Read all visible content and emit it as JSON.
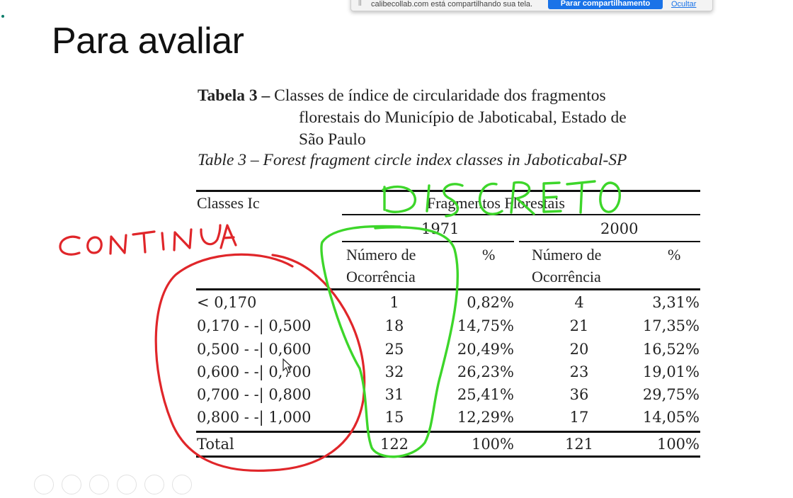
{
  "share_bar": {
    "message": "calibecollab.com está compartilhando sua tela.",
    "stop_label": "Parar compartilhamento",
    "hide_label": "Ocultar"
  },
  "slide": {
    "title": "Para avaliar"
  },
  "document": {
    "caption_prefix": "Tabela 3 –",
    "caption_line1": "Classes de índice de circularidade  dos fragmentos",
    "caption_line2": "florestais do Município de Jaboticabal, Estado de",
    "caption_line3": "São Paulo",
    "caption_en": "Table 3 – Forest fragment circle index classes in Jaboticabal-SP"
  },
  "table": {
    "header_classes": "Classes Ic",
    "header_group": "Fragmentos Florestais",
    "year_1": "1971",
    "year_2": "2000",
    "col_num_line1": "Número de",
    "col_num_line2": "Ocorrência",
    "col_pct": "%",
    "rows": [
      {
        "cls": "< 0,170",
        "n1": "1",
        "p1": "0,82%",
        "n2": "4",
        "p2": "3,31%"
      },
      {
        "cls": "0,170 - -| 0,500",
        "n1": "18",
        "p1": "14,75%",
        "n2": "21",
        "p2": "17,35%"
      },
      {
        "cls": "0,500 - -| 0,600",
        "n1": "25",
        "p1": "20,49%",
        "n2": "20",
        "p2": "16,52%"
      },
      {
        "cls": "0,600 - -| 0,700",
        "n1": "32",
        "p1": "26,23%",
        "n2": "23",
        "p2": "19,01%"
      },
      {
        "cls": "0,700 - -| 0,800",
        "n1": "31",
        "p1": "25,41%",
        "n2": "36",
        "p2": "29,75%"
      },
      {
        "cls": "0,800 - -| 1,000",
        "n1": "15",
        "p1": "12,29%",
        "n2": "17",
        "p2": "14,05%"
      }
    ],
    "total": {
      "cls": "Total",
      "n1": "122",
      "p1": "100%",
      "n2": "121",
      "p2": "100%"
    }
  },
  "annotations": {
    "red_label": "CONTINUA",
    "green_label": "DISCRETO",
    "red_color": "#e0262a",
    "green_color": "#3dd62a"
  }
}
